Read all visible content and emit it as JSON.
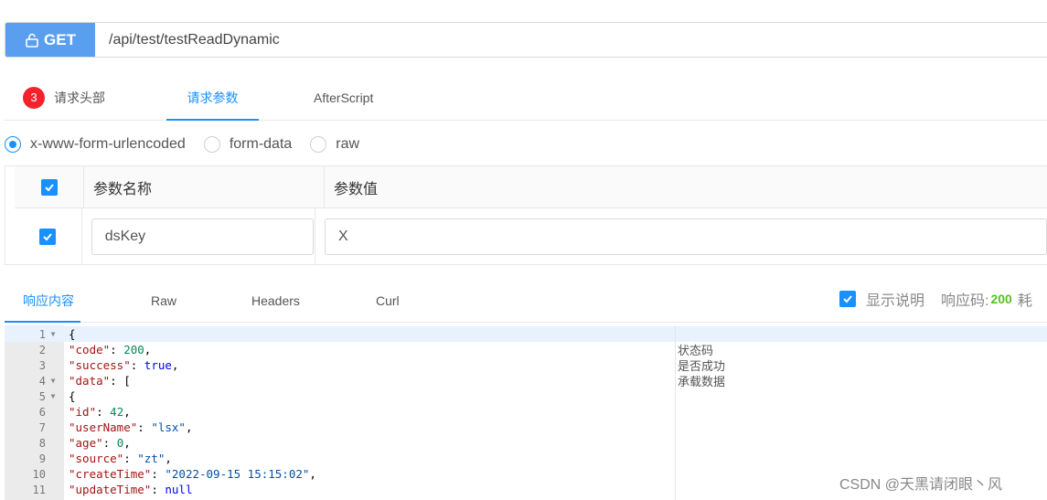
{
  "request": {
    "method": "GET",
    "url": "/api/test/testReadDynamic"
  },
  "request_tabs": [
    {
      "label": "请求头部",
      "badge": "3"
    },
    {
      "label": "请求参数"
    },
    {
      "label": "AfterScript"
    }
  ],
  "body_types": [
    {
      "label": "x-www-form-urlencoded",
      "checked": true
    },
    {
      "label": "form-data",
      "checked": false
    },
    {
      "label": "raw",
      "checked": false
    }
  ],
  "params_table": {
    "headers": [
      "参数名称",
      "参数值"
    ],
    "rows": [
      {
        "checked": true,
        "name": "dsKey",
        "value": "X"
      }
    ]
  },
  "response_tabs": [
    "响应内容",
    "Raw",
    "Headers",
    "Curl"
  ],
  "response_meta": {
    "show_desc_label": "显示说明",
    "code_label": "响应码:",
    "code_value": "200",
    "trailing": "耗"
  },
  "code_lines": [
    {
      "num": "1",
      "fold": "▼"
    },
    {
      "num": "2",
      "fold": ""
    },
    {
      "num": "3",
      "fold": ""
    },
    {
      "num": "4",
      "fold": "▼"
    },
    {
      "num": "5",
      "fold": "▼"
    },
    {
      "num": "6",
      "fold": ""
    },
    {
      "num": "7",
      "fold": ""
    },
    {
      "num": "8",
      "fold": ""
    },
    {
      "num": "9",
      "fold": ""
    },
    {
      "num": "10",
      "fold": ""
    },
    {
      "num": "11",
      "fold": ""
    }
  ],
  "code": {
    "l1": "{",
    "code_key": "\"code\"",
    "code_val": "200",
    "success_key": "\"success\"",
    "success_val": "true",
    "data_key": "\"data\"",
    "data_open": "[",
    "l5": "{",
    "id_key": "\"id\"",
    "id_val": "42",
    "username_key": "\"userName\"",
    "username_val": "\"lsx\"",
    "age_key": "\"age\"",
    "age_val": "0",
    "source_key": "\"source\"",
    "source_val": "\"zt\"",
    "createtime_key": "\"createTime\"",
    "createtime_val": "\"2022-09-15 15:15:02\"",
    "updatetime_key": "\"updateTime\"",
    "updatetime_val": "null"
  },
  "descriptions": [
    "状态码",
    "是否成功",
    "承载数据"
  ],
  "watermark": "CSDN @天黑请闭眼丶风"
}
